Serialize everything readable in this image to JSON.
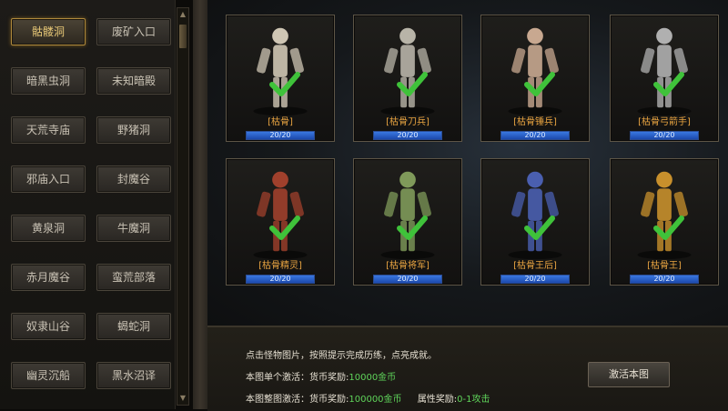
{
  "locations": [
    {
      "label": "骷髅洞",
      "selected": true
    },
    {
      "label": "废矿入口",
      "selected": false
    },
    {
      "label": "暗黑虫洞",
      "selected": false
    },
    {
      "label": "未知暗殿",
      "selected": false
    },
    {
      "label": "天荒寺庙",
      "selected": false
    },
    {
      "label": "野猪洞",
      "selected": false
    },
    {
      "label": "邪庙入口",
      "selected": false
    },
    {
      "label": "封魔谷",
      "selected": false
    },
    {
      "label": "黄泉洞",
      "selected": false
    },
    {
      "label": "牛魔洞",
      "selected": false
    },
    {
      "label": "赤月魔谷",
      "selected": false
    },
    {
      "label": "蛮荒部落",
      "selected": false
    },
    {
      "label": "奴隶山谷",
      "selected": false
    },
    {
      "label": "蝎蛇洞",
      "selected": false
    },
    {
      "label": "幽灵沉船",
      "selected": false
    },
    {
      "label": "黑水沼译",
      "selected": false
    }
  ],
  "monsters": [
    {
      "name": "[枯骨]",
      "progress": "20/20",
      "fill": 1.0,
      "color": "#cfc6b4"
    },
    {
      "name": "[枯骨刀兵]",
      "progress": "20/20",
      "fill": 1.0,
      "color": "#b8b4a8"
    },
    {
      "name": "[枯骨锤兵]",
      "progress": "20/20",
      "fill": 1.0,
      "color": "#c8a890"
    },
    {
      "name": "[枯骨弓箭手]",
      "progress": "20/20",
      "fill": 1.0,
      "color": "#b0b0b0"
    },
    {
      "name": "[枯骨精灵]",
      "progress": "20/20",
      "fill": 1.0,
      "color": "#a0402c"
    },
    {
      "name": "[枯骨将军]",
      "progress": "20/20",
      "fill": 1.0,
      "color": "#7f9a5a"
    },
    {
      "name": "[枯骨王后]",
      "progress": "20/20",
      "fill": 1.0,
      "color": "#4a5fb0"
    },
    {
      "name": "[枯骨王]",
      "progress": "20/20",
      "fill": 1.0,
      "color": "#c8902c"
    }
  ],
  "info": {
    "line1": "点击怪物图片，按照提示完成历练，点亮成就。",
    "line2_label": "本图单个激活：货币奖励:",
    "line2_value": "10000金币",
    "line3_label": "本图整图激活：货币奖励:",
    "line3_value": "100000金币",
    "line3_attr_label": "属性奖励:",
    "line3_attr_value": "0-1攻击"
  },
  "activate_label": "激活本图",
  "colors": {
    "accent_gold": "#e8c877",
    "name_orange": "#e9a441",
    "check_green": "#3fc23a",
    "value_green": "#5fd45a"
  }
}
